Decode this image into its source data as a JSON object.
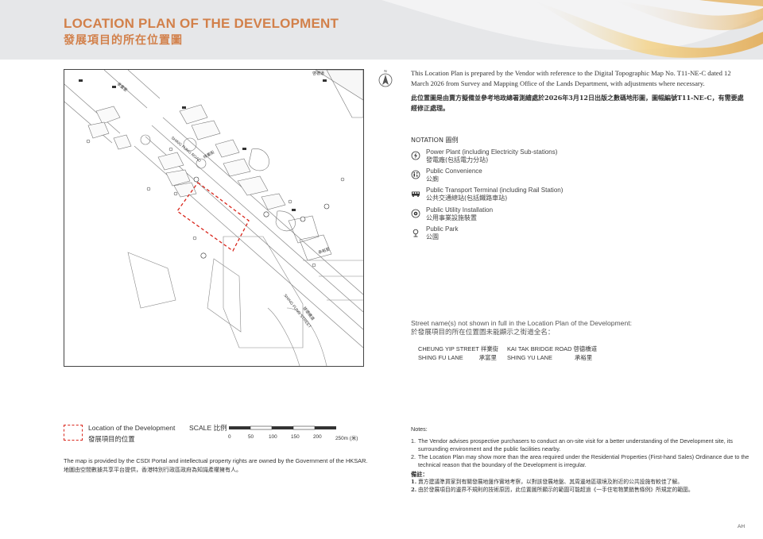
{
  "header": {
    "title_en": "LOCATION PLAN OF THE DEVELOPMENT",
    "title_zh": "發展項目的所在位置圖"
  },
  "intro": {
    "en": "This Location Plan is prepared by the Vendor with reference to the Digital Topographic Map No. T11-NE-C dated 12 March 2026 from Survey and Mapping Office of the Lands Department, with adjustments where necessary.",
    "zh": "此位置圖是由賣方擬備並參考地政總署測繪處於2026年3月12日出版之數碼地形圖，圖幅編號T11-NE-C，有需要處經修正處理。"
  },
  "notation": {
    "title": "NOTATION 圖例",
    "items": [
      {
        "en": "Power Plant (including Electricity Sub-stations)",
        "zh": "發電廠(包括電力分站)",
        "icon": "power-plant-icon"
      },
      {
        "en": "Public Convenience",
        "zh": "公廁",
        "icon": "public-convenience-icon"
      },
      {
        "en": "Public Transport Terminal (including Rail Station)",
        "zh": "公共交通總站(包括鐵路車站)",
        "icon": "transport-terminal-icon"
      },
      {
        "en": "Public Utility Installation",
        "zh": "公用事業設施裝置",
        "icon": "utility-installation-icon"
      },
      {
        "en": "Public Park",
        "zh": "公園",
        "icon": "park-icon"
      }
    ]
  },
  "streets": {
    "title_en": "Street name(s) not shown in full in the Location Plan of the Development:",
    "title_zh": "於發展項目的所在位置圖未能顯示之街道全名：",
    "rows": [
      [
        {
          "en": "CHEUNG YIP STREET",
          "zh": "祥業街"
        },
        {
          "en": "KAI TAK BRIDGE ROAD",
          "zh": "啓德橋道"
        }
      ],
      [
        {
          "en": "SHING FU LANE",
          "zh": "承富里"
        },
        {
          "en": "SHING YU LANE",
          "zh": "承裕里"
        }
      ]
    ]
  },
  "map": {
    "labels": {
      "shing_fung_road": "SHING FUNG ROAD",
      "shing_fung_street": "SHING FUNG STREET",
      "kai_tak_bridge": "啓德橋道",
      "shing_yu": "承裕里",
      "cheung_yip": "祥業街",
      "shing_fu": "承富里",
      "top_street": "啓德道"
    }
  },
  "development_legend": {
    "en": "Location of the Development",
    "zh": "發展項目的位置"
  },
  "scale": {
    "label": "SCALE 比例",
    "ticks": [
      "0",
      "50",
      "100",
      "150",
      "200",
      "250m (米)"
    ]
  },
  "csdi": {
    "en": "The map is provided by the CSDI Portal and intellectual property rights are owned by the Government of the HKSAR.",
    "zh": "地圖由空間數據共享平台提供，香港特別行政區政府為知識產權擁有人。"
  },
  "notes": {
    "title": "Notes:",
    "items_en": [
      "The Vendor advises prospective purchasers to conduct an on-site visit for a better understanding of the Development site, its surrounding environment and the public facilities nearby.",
      "The Location Plan may show more than the area required under the Residential Properties (First-hand Sales) Ordinance due to the technical reason that the boundary of the Development is irregular."
    ],
    "title_zh": "備註：",
    "items_zh": [
      "賣方建議準買家到有關發展地盤作實地考察，以對該發展地盤、其周邊地區環境及附近的公共設施有較佳了解。",
      "由於發展項目的邊界不規則的技術原因，此位置圖所顯示的範圍可能超過《一手住宅物業銷售條例》所規定的範圍。"
    ],
    "numbers": [
      "1.",
      "2."
    ]
  },
  "page_code": "AH",
  "colors": {
    "title": "#d2804a",
    "development_boundary": "#d9261c",
    "header_bg": "#e6e7e9"
  }
}
